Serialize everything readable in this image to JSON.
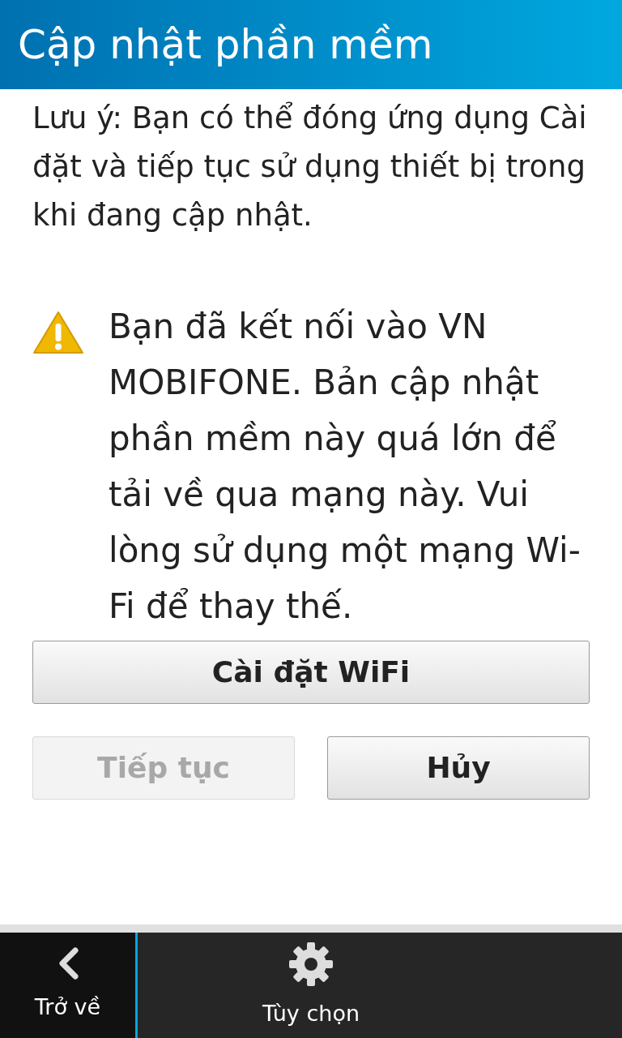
{
  "title_bar": {
    "title": "Cập nhật phần mềm"
  },
  "note": "Lưu ý: Bạn có thể đóng ứng dụng Cài đặt và tiếp tục sử dụng thiết bị trong khi đang cập nhật.",
  "warning": {
    "message": "Bạn đã kết nối vào VN MOBIFONE. Bản cập nhật phần mềm này quá lớn để tải về qua mạng này. Vui lòng sử dụng một mạng Wi-Fi để thay thế."
  },
  "wifi_button": {
    "label": "Cài đặt WiFi",
    "disabled": false
  },
  "buttons": [
    {
      "label": "Tiếp tục",
      "disabled": true
    },
    {
      "label": "Hủy",
      "disabled": false
    }
  ],
  "action_bar": {
    "back": "Trở về",
    "options": "Tùy chọn"
  }
}
